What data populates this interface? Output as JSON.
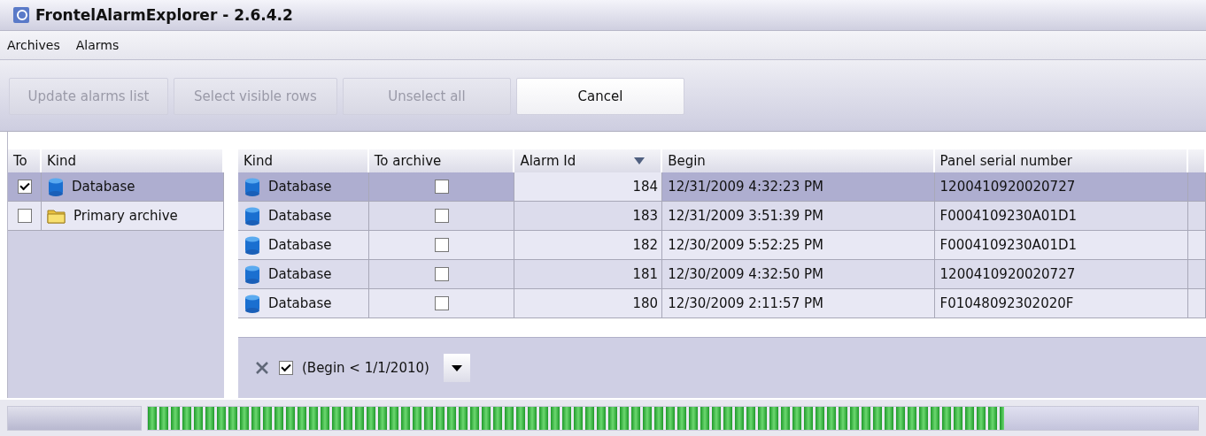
{
  "window": {
    "title": "FrontelAlarmExplorer - 2.6.4.2"
  },
  "menu": [
    "Archives",
    "Alarms"
  ],
  "toolbar": [
    {
      "label": "Update alarms list",
      "disabled": true
    },
    {
      "label": "Select visible rows",
      "disabled": true
    },
    {
      "label": "Unselect all",
      "disabled": true
    },
    {
      "label": "Cancel",
      "disabled": false
    }
  ],
  "archives": {
    "columns": [
      "To",
      "Kind"
    ],
    "rows": [
      {
        "checked": true,
        "kind": "database",
        "label": "Database",
        "selected": true
      },
      {
        "checked": false,
        "kind": "folder",
        "label": "Primary archive",
        "selected": false
      }
    ]
  },
  "alarms": {
    "columns": [
      {
        "label": "Kind",
        "sorted": false
      },
      {
        "label": "To archive",
        "sorted": false
      },
      {
        "label": "Alarm Id",
        "sorted": true
      },
      {
        "label": "Begin",
        "sorted": false
      },
      {
        "label": "Panel serial number",
        "sorted": false
      }
    ],
    "rows": [
      {
        "kind": "Database",
        "to_archive": false,
        "alarm_id": "184",
        "begin": "12/31/2009 4:32:23 PM",
        "panel_serial": "1200410920020727",
        "selected": true
      },
      {
        "kind": "Database",
        "to_archive": false,
        "alarm_id": "183",
        "begin": "12/31/2009 3:51:39 PM",
        "panel_serial": "F0004109230A01D1",
        "selected": false
      },
      {
        "kind": "Database",
        "to_archive": false,
        "alarm_id": "182",
        "begin": "12/30/2009 5:52:25 PM",
        "panel_serial": "F0004109230A01D1",
        "selected": false
      },
      {
        "kind": "Database",
        "to_archive": false,
        "alarm_id": "181",
        "begin": "12/30/2009 4:32:50 PM",
        "panel_serial": "1200410920020727",
        "selected": false
      },
      {
        "kind": "Database",
        "to_archive": false,
        "alarm_id": "180",
        "begin": "12/30/2009 2:11:57 PM",
        "panel_serial": "F01048092302020F",
        "selected": false
      }
    ],
    "filter": {
      "enabled": true,
      "text": "(Begin < 1/1/2010)"
    }
  },
  "status_bar": {
    "progress": {
      "level": 0.815
    }
  }
}
